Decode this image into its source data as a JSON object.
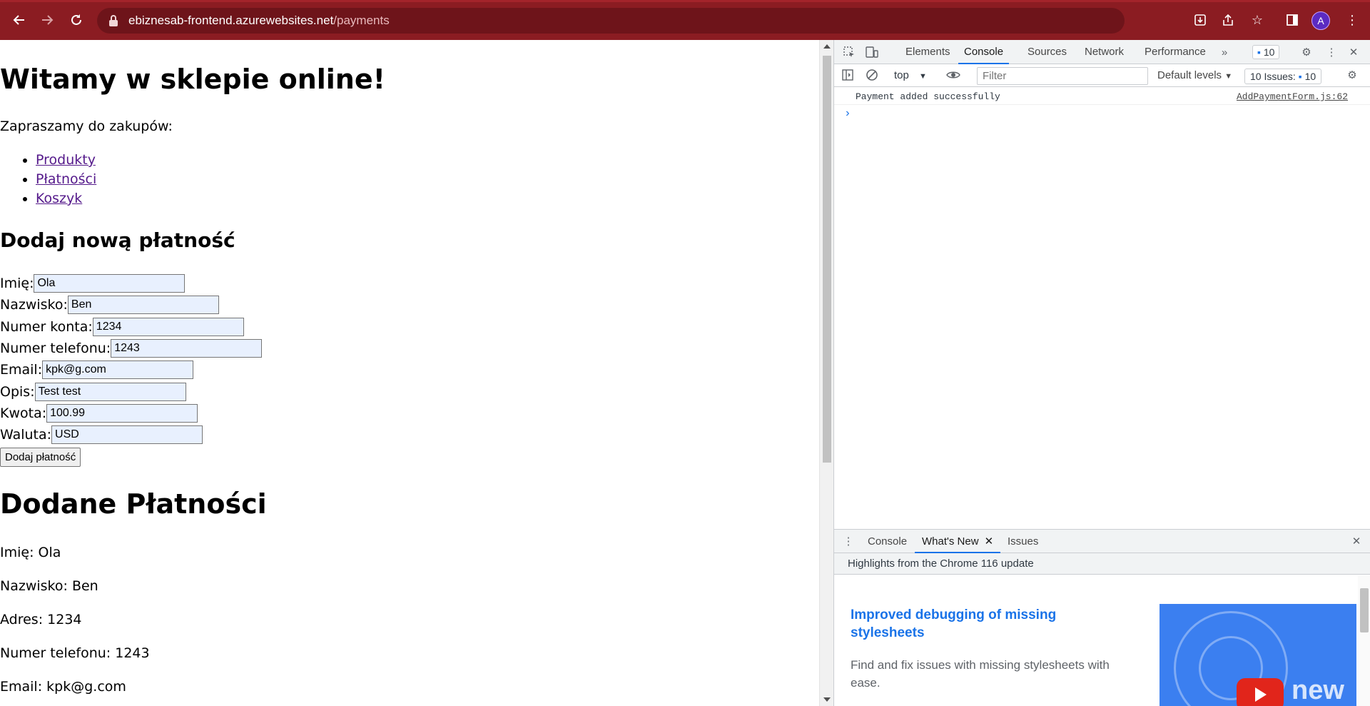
{
  "browser": {
    "url_host": "ebiznesab-frontend.azurewebsites.net",
    "url_path": "/payments",
    "avatar_letter": "A"
  },
  "page": {
    "heading": "Witamy w sklepie online!",
    "intro": "Zapraszamy do zakupów:",
    "nav_links": [
      "Produkty",
      "Płatności",
      "Koszyk"
    ],
    "form_heading": "Dodaj nową płatność",
    "form_fields": [
      {
        "label": "Imię:",
        "value": "Ola"
      },
      {
        "label": "Nazwisko:",
        "value": "Ben"
      },
      {
        "label": "Numer konta:",
        "value": "1234"
      },
      {
        "label": "Numer telefonu:",
        "value": "1243"
      },
      {
        "label": "Email:",
        "value": "kpk@g.com"
      },
      {
        "label": "Opis:",
        "value": "Test test"
      },
      {
        "label": "Kwota:",
        "value": "100.99"
      },
      {
        "label": "Waluta:",
        "value": "USD"
      }
    ],
    "submit_label": "Dodaj płatność",
    "list_heading": "Dodane Płatności",
    "payment_details": [
      "Imię: Ola",
      "Nazwisko: Ben",
      "Adres: 1234",
      "Numer telefonu: 1243",
      "Email: kpk@g.com"
    ]
  },
  "devtools": {
    "tabs": [
      "Elements",
      "Console",
      "Sources",
      "Network",
      "Performance"
    ],
    "active_tab": "Console",
    "messages_badge": "10",
    "context": "top",
    "filter_placeholder": "Filter",
    "levels": "Default levels",
    "issues_label": "10 Issues:",
    "issues_count": "10",
    "console_message": "Payment added successfully",
    "console_source": "AddPaymentForm.js:62",
    "drawer_tabs": [
      "Console",
      "What's New",
      "Issues"
    ],
    "drawer_active": "What's New",
    "drawer_heading": "Highlights from the Chrome 116 update",
    "whats_new_title": "Improved debugging of missing stylesheets",
    "whats_new_desc": "Find and fix issues with missing stylesheets with ease.",
    "video_badge": "new"
  }
}
